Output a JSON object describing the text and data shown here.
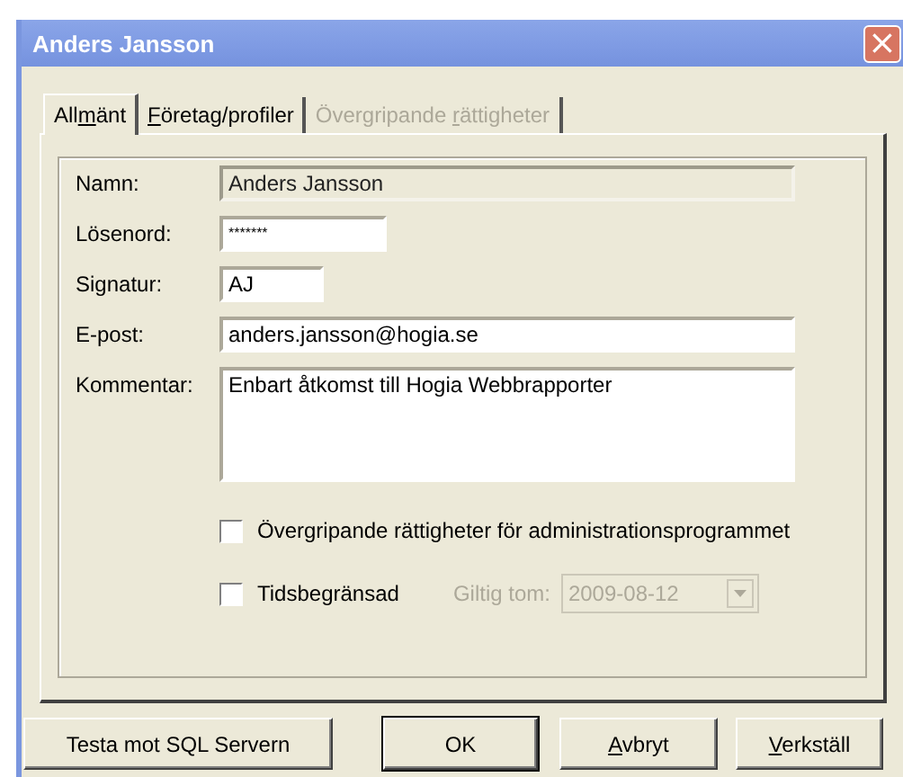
{
  "window": {
    "title": "Anders Jansson",
    "close": "×"
  },
  "tabs": [
    {
      "label_start": "All",
      "access_key": "m",
      "label_end": "änt",
      "selected": true,
      "disabled": false
    },
    {
      "access_key": "F",
      "label_end": "öretag/profiler",
      "selected": false,
      "disabled": false
    },
    {
      "label_start": "Övergripande ",
      "access_key": "r",
      "label_end": "ättigheter",
      "selected": false,
      "disabled": true
    }
  ],
  "fields": [
    {
      "kind": "text",
      "label": "Namn:",
      "value": "Anders Jansson",
      "readonly": true
    },
    {
      "kind": "password",
      "label": "Lösenord:",
      "value": "*******",
      "readonly": false
    },
    {
      "kind": "text",
      "label": "Signatur:",
      "value": "AJ",
      "readonly": false
    },
    {
      "kind": "text",
      "label": "E-post:",
      "value": "anders.jansson@hogia.se",
      "readonly": false
    },
    {
      "kind": "textarea",
      "label": "Kommentar:",
      "value": "Enbart åtkomst till Hogia Webbrapporter",
      "readonly": false
    }
  ],
  "options": [
    {
      "label": "Övergripande rättigheter för administrationsprogrammet",
      "checked": false
    },
    {
      "label": "Tidsbegränsad",
      "checked": false
    }
  ],
  "valid_until": {
    "label": "Giltig tom:",
    "value": "2009-08-12",
    "disabled": true
  },
  "buttons": [
    {
      "label_start": "Testa mot SQL Servern",
      "default": false
    },
    {
      "label_start": "OK",
      "default": true
    },
    {
      "access_key": "A",
      "label_end": "vbryt",
      "default": false
    },
    {
      "access_key": "V",
      "label_end": "erkställ",
      "default": false
    }
  ]
}
